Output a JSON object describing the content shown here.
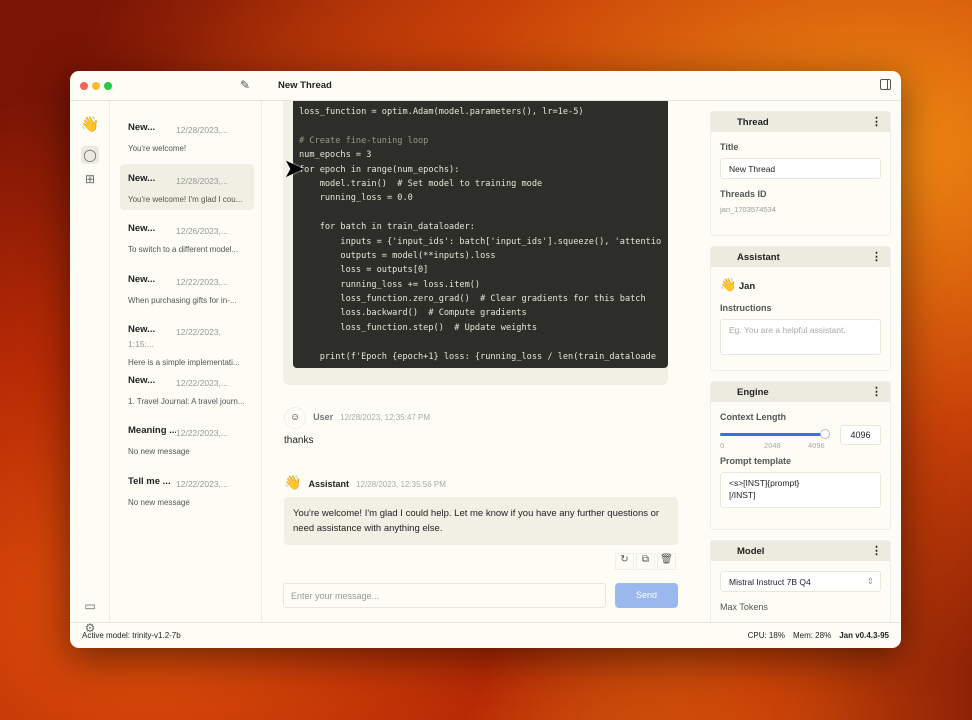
{
  "window": {
    "title": "New Thread"
  },
  "threads": [
    {
      "title": "New...",
      "date": "12/28/2023,...",
      "preview": "You're welcome!"
    },
    {
      "title": "New...",
      "date": "12/28/2023,...",
      "preview": "You're welcome! I'm glad I cou..."
    },
    {
      "title": "New...",
      "date": "12/26/2023,...",
      "preview": "To switch to a different model..."
    },
    {
      "title": "New...",
      "date": "12/22/2023,...",
      "preview": "When purchasing gifts for in-..."
    },
    {
      "title": "New...",
      "date": "12/22/2023, 1:15:...",
      "preview": "Here is a simple implementati..."
    },
    {
      "title": "New...",
      "date": "12/22/2023,...",
      "preview": "1. Travel Journal: A travel journ..."
    },
    {
      "title": "Meaning ...",
      "date": "12/22/2023,...",
      "preview": "No new message"
    },
    {
      "title": "Tell me ...",
      "date": "12/22/2023,...",
      "preview": "No new message"
    }
  ],
  "code_lines": [
    "loss_function = optim.Adam(model.parameters(), lr=1e-5)",
    "",
    "# Create fine-tuning loop",
    "num_epochs = 3",
    "for epoch in range(num_epochs):",
    "    model.train()  # Set model to training mode",
    "    running_loss = 0.0",
    "",
    "    for batch in train_dataloader:",
    "        inputs = {'input_ids': batch['input_ids'].squeeze(), 'attentio",
    "        outputs = model(**inputs).loss",
    "        loss = outputs[0]",
    "        running_loss += loss.item()",
    "        loss_function.zero_grad()  # Clear gradients for this batch",
    "        loss.backward()  # Compute gradients",
    "        loss_function.step()  # Update weights",
    "",
    "    print(f'Epoch {epoch+1} loss: {running_loss / len(train_dataloade"
  ],
  "messages": [
    {
      "sender": "User",
      "time": "12/28/2023, 12:35:47 PM",
      "text": "thanks"
    },
    {
      "sender": "Assistant",
      "time": "12/28/2023, 12:35:56 PM",
      "text": "You're welcome! I'm glad I could help. Let me know if you have any further questions or need assistance with anything else."
    }
  ],
  "composer": {
    "placeholder": "Enter your message...",
    "send_label": "Send"
  },
  "panel": {
    "thread": {
      "header": "Thread",
      "title_label": "Title",
      "title_value": "New Thread",
      "id_label": "Threads ID",
      "id_value": "jan_1703574534"
    },
    "assistant": {
      "header": "Assistant",
      "name": "Jan",
      "instructions_label": "Instructions",
      "instructions_placeholder": "Eg. You are a helpful assistant."
    },
    "engine": {
      "header": "Engine",
      "context_label": "Context Length",
      "context_value": "4096",
      "context_fraction": 1.0,
      "ticks": [
        "0",
        "2048",
        "4096"
      ],
      "prompt_label": "Prompt template",
      "prompt_value": "<s>[INST]{prompt}\n[/INST]"
    },
    "model": {
      "header": "Model",
      "selected": "Mistral Instruct 7B Q4",
      "max_tokens_label": "Max Tokens"
    }
  },
  "status": {
    "active_model": "Active model: trinity-v1.2-7b",
    "cpu": "CPU: 18%",
    "mem": "Mem: 28%",
    "version": "Jan v0.4.3-95"
  },
  "colors": {
    "accent": "#3b6fe0",
    "send": "#9bb8ee"
  }
}
